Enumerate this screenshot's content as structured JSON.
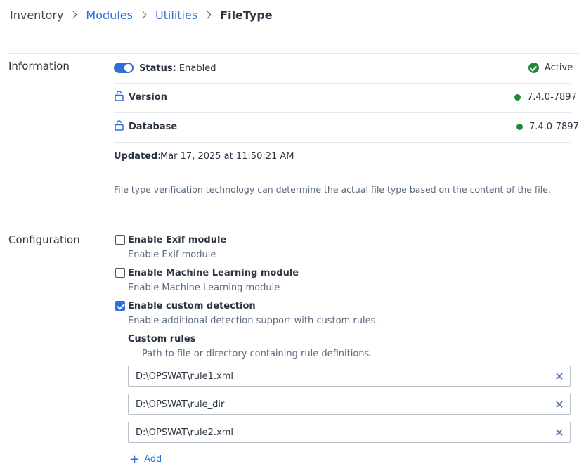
{
  "breadcrumb": {
    "items": [
      "Inventory",
      "Modules",
      "Utilities"
    ],
    "current": "FileType"
  },
  "information": {
    "title": "Information",
    "status_label": "Status:",
    "status_value": "Enabled",
    "status_badge": "Active",
    "version_label": "Version",
    "version_value": "7.4.0-7897",
    "database_label": "Database",
    "database_value": "7.4.0-7897",
    "updated_label": "Updated:",
    "updated_value": "Mar 17, 2025 at 11:50:21 AM",
    "description": "File type verification technology can determine the actual file type based on the content of the file."
  },
  "configuration": {
    "title": "Configuration",
    "exif": {
      "label": "Enable Exif module",
      "help": "Enable Exif module",
      "checked": false
    },
    "ml": {
      "label": "Enable Machine Learning module",
      "help": "Enable Machine Learning module",
      "checked": false
    },
    "custom": {
      "label": "Enable custom detection",
      "help": "Enable additional detection support with custom rules.",
      "checked": true
    },
    "rules_title": "Custom rules",
    "rules_help": "Path to file or directory containing rule definitions.",
    "rules": [
      "D:\\OPSWAT\\rule1.xml",
      "D:\\OPSWAT\\rule_dir",
      "D:\\OPSWAT\\rule2.xml"
    ],
    "add_label": "Add"
  },
  "colors": {
    "accent": "#2f6fd6",
    "success": "#1e8a3c",
    "divider": "#e4e7eb"
  }
}
